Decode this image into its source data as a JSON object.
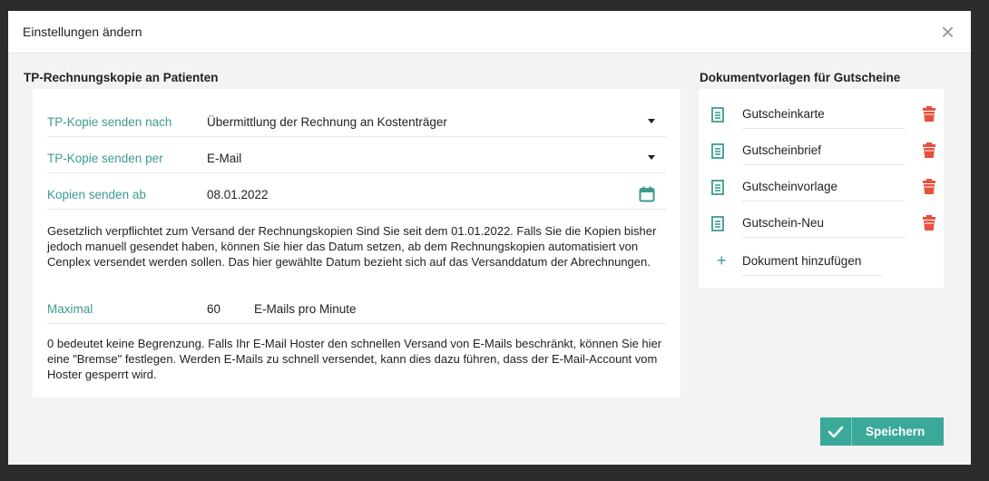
{
  "dialog": {
    "title": "Einstellungen ändern",
    "close_label": "×"
  },
  "tp_section": {
    "title": "TP-Rechnungskopie an Patienten",
    "send_to": {
      "label": "TP-Kopie senden nach",
      "value": "Übermittlung der Rechnung an Kostenträger"
    },
    "send_via": {
      "label": "TP-Kopie senden per",
      "value": "E-Mail"
    },
    "send_from": {
      "label": "Kopien senden ab",
      "value": "08.01.2022"
    },
    "info_text": "Gesetzlich verpflichtet zum Versand der Rechnungskopien Sind Sie seit dem 01.01.2022. Falls Sie die Kopien bisher jedoch manuell gesendet haben, können Sie hier das Datum setzen, ab dem Rechnungskopien automatisiert von Cenplex versendet werden sollen. Das hier gewählte Datum bezieht sich auf das Versanddatum der Abrechnungen.",
    "max": {
      "label": "Maximal",
      "value": "60",
      "suffix": "E-Mails pro Minute"
    },
    "limit_text": "0 bedeutet keine Begrenzung. Falls Ihr E-Mail Hoster den schnellen Versand von E-Mails beschränkt, können Sie hier eine \"Bremse\" festlegen. Werden E-Mails zu schnell versendet, kann dies dazu führen, dass der E-Mail-Account vom Hoster gesperrt wird."
  },
  "docs_section": {
    "title": "Dokumentvorlagen für Gutscheine",
    "items": [
      {
        "name": "Gutscheinkarte"
      },
      {
        "name": "Gutscheinbrief"
      },
      {
        "name": "Gutscheinvorlage"
      },
      {
        "name": "Gutschein-Neu"
      }
    ],
    "add_label": "Dokument hinzufügen"
  },
  "footer": {
    "save_label": "Speichern"
  },
  "colors": {
    "accent": "#3aa99a",
    "label_teal": "#3d9a8f",
    "trash_red": "#e8503a"
  },
  "icons": {
    "calendar": "calendar-icon",
    "document": "document-icon",
    "trash": "trash-icon",
    "plus": "plus-icon",
    "check": "check-icon",
    "close": "close-icon"
  }
}
